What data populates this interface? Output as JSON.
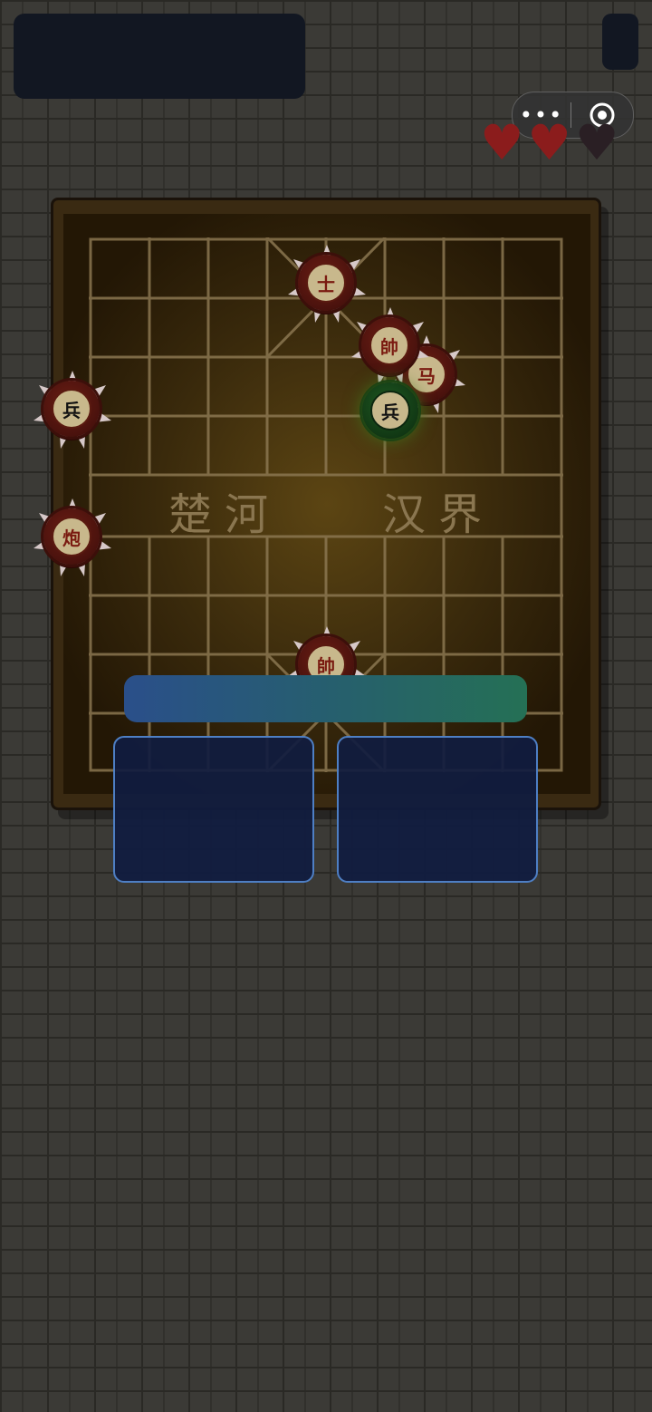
{
  "header": {
    "capsule": {
      "more_label": "•••",
      "icons": [
        "more-icon",
        "target-icon"
      ]
    },
    "lives": {
      "filled": 2,
      "total": 3,
      "colors": {
        "filled": "#8b1c1c",
        "empty": "#2a1f24"
      }
    }
  },
  "board": {
    "river_left": "楚河",
    "river_right": "汉界",
    "pieces": [
      {
        "label": "士",
        "side": "red"
      },
      {
        "label": "帥",
        "side": "red"
      },
      {
        "label": "马",
        "side": "red"
      },
      {
        "label": "兵",
        "side": "green"
      },
      {
        "label": "兵",
        "side": "red"
      },
      {
        "label": "炮",
        "side": "red"
      },
      {
        "label": "帥",
        "side": "red"
      }
    ]
  },
  "overlay": {
    "bar_colors": [
      "#2a4f8a",
      "#257055"
    ],
    "buttons": [
      {
        "label": ""
      },
      {
        "label": ""
      }
    ]
  }
}
